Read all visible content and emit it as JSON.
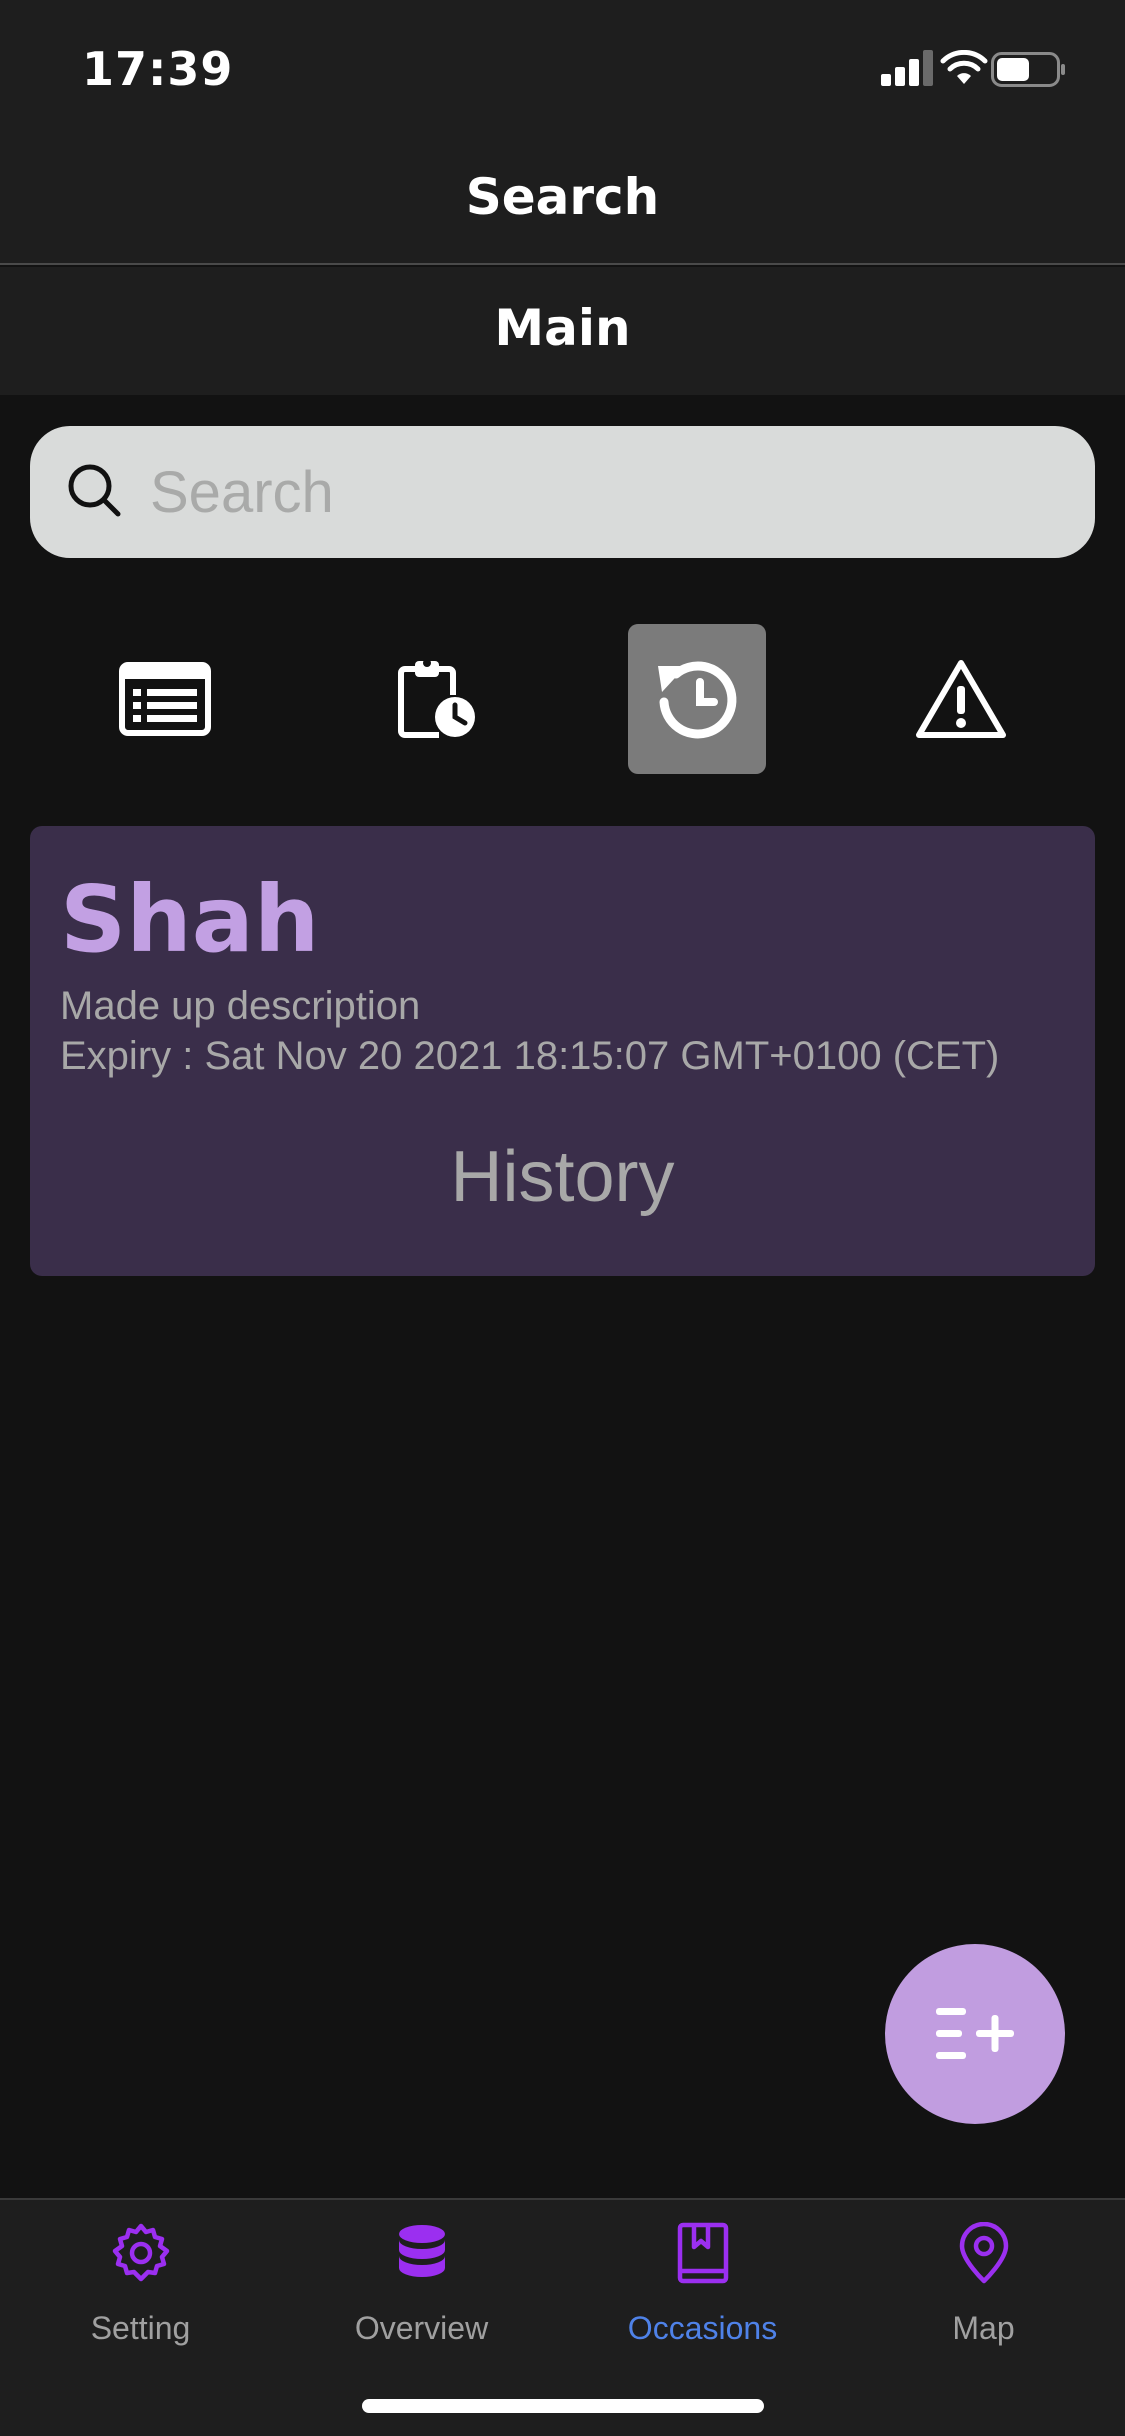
{
  "status_bar": {
    "time": "17:39"
  },
  "header": {
    "title": "Search"
  },
  "subheader": {
    "title": "Main"
  },
  "search": {
    "placeholder": "Search",
    "value": ""
  },
  "filters": [
    {
      "icon": "list-icon",
      "active": false
    },
    {
      "icon": "clipboard-clock-icon",
      "active": false
    },
    {
      "icon": "history-icon",
      "active": true
    },
    {
      "icon": "warning-icon",
      "active": false
    }
  ],
  "card": {
    "title": "Shah",
    "description": "Made up description",
    "expiry": "Expiry : Sat Nov 20 2021 18:15:07 GMT+0100 (CET)",
    "tag": "History"
  },
  "fab": {
    "icon": "add-list-icon"
  },
  "tabs": [
    {
      "label": "Setting",
      "icon": "gear-icon",
      "active": false
    },
    {
      "label": "Overview",
      "icon": "database-icon",
      "active": false
    },
    {
      "label": "Occasions",
      "icon": "bookmark-book-icon",
      "active": true
    },
    {
      "label": "Map",
      "icon": "map-pin-icon",
      "active": false
    }
  ],
  "colors": {
    "accent": "#c19de0",
    "active_tab": "#4f82e8",
    "tab_icon": "#9b2ff0",
    "card_bg": "#3a2e4a"
  }
}
